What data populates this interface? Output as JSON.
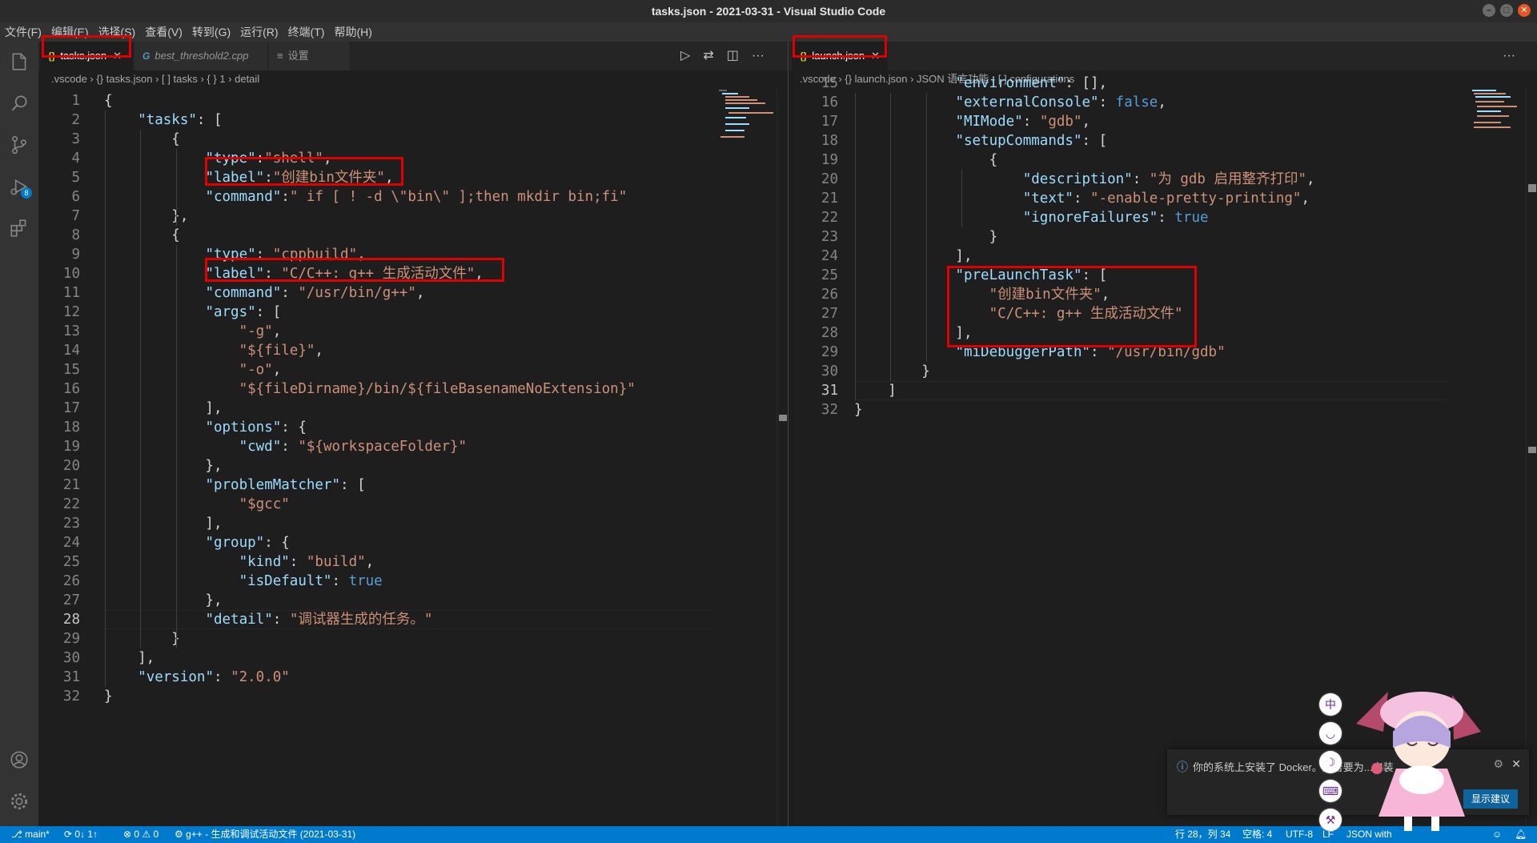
{
  "window": {
    "title": "tasks.json - 2021-03-31 - Visual Studio Code",
    "minimize": "–",
    "maximize": "□",
    "close": "✕"
  },
  "menu": [
    "文件(F)",
    "编辑(E)",
    "选择(S)",
    "查看(V)",
    "转到(G)",
    "运行(R)",
    "终端(T)",
    "帮助(H)"
  ],
  "activity": {
    "scm_badge": "8",
    "explorer_icon": "files-icon",
    "search_icon": "search-icon",
    "scm_icon": "source-control-icon",
    "debug_icon": "run-debug-icon",
    "ext_icon": "extensions-icon",
    "account_icon": "account-icon",
    "settings_icon": "gear-icon"
  },
  "left": {
    "tabs": [
      {
        "icon": "{}",
        "label": "tasks.json",
        "close": "✕"
      },
      {
        "icon": "G",
        "label": "best_threshold2.cpp"
      },
      {
        "icon": "≡",
        "label": "设置"
      }
    ],
    "breadcrumb": [
      ".vscode",
      "{} tasks.json",
      "[ ] tasks",
      "{ } 1",
      "detail"
    ],
    "actions": {
      "run": "▷",
      "compare": "⇄",
      "split": "◫",
      "more": "···"
    },
    "lines": [
      {
        "n": "1",
        "t": "{"
      },
      {
        "n": "2",
        "t": "    \"tasks\": ["
      },
      {
        "n": "3",
        "t": "        {"
      },
      {
        "n": "4",
        "t": "            \"type\":\"shell\","
      },
      {
        "n": "5",
        "t": "            \"label\":\"创建bin文件夹\","
      },
      {
        "n": "6",
        "t": "            \"command\":\" if [ ! -d \\\"bin\\\" ];then mkdir bin;fi\""
      },
      {
        "n": "7",
        "t": "        },"
      },
      {
        "n": "8",
        "t": "        {"
      },
      {
        "n": "9",
        "t": "            \"type\": \"cppbuild\","
      },
      {
        "n": "10",
        "t": "            \"label\": \"C/C++: g++ 生成活动文件\","
      },
      {
        "n": "11",
        "t": "            \"command\": \"/usr/bin/g++\","
      },
      {
        "n": "12",
        "t": "            \"args\": ["
      },
      {
        "n": "13",
        "t": "                \"-g\","
      },
      {
        "n": "14",
        "t": "                \"${file}\","
      },
      {
        "n": "15",
        "t": "                \"-o\","
      },
      {
        "n": "16",
        "t": "                \"${fileDirname}/bin/${fileBasenameNoExtension}\""
      },
      {
        "n": "17",
        "t": "            ],"
      },
      {
        "n": "18",
        "t": "            \"options\": {"
      },
      {
        "n": "19",
        "t": "                \"cwd\": \"${workspaceFolder}\""
      },
      {
        "n": "20",
        "t": "            },"
      },
      {
        "n": "21",
        "t": "            \"problemMatcher\": ["
      },
      {
        "n": "22",
        "t": "                \"$gcc\""
      },
      {
        "n": "23",
        "t": "            ],"
      },
      {
        "n": "24",
        "t": "            \"group\": {"
      },
      {
        "n": "25",
        "t": "                \"kind\": \"build\","
      },
      {
        "n": "26",
        "t": "                \"isDefault\": true"
      },
      {
        "n": "27",
        "t": "            },"
      },
      {
        "n": "28",
        "t": "            \"detail\": \"调试器生成的任务。\""
      },
      {
        "n": "29",
        "t": "        }"
      },
      {
        "n": "30",
        "t": "    ],"
      },
      {
        "n": "31",
        "t": "    \"version\": \"2.0.0\""
      },
      {
        "n": "32",
        "t": "}"
      }
    ]
  },
  "right": {
    "tabs": [
      {
        "icon": "{}",
        "label": "launch.json",
        "close": "✕"
      }
    ],
    "breadcrumb": [
      ".vscode",
      "{} launch.json",
      "JSON 语言功能",
      "[ ] configurations"
    ],
    "actions": {
      "more": "···"
    },
    "lines": [
      {
        "n": "15",
        "t": "            \"environment\": [],"
      },
      {
        "n": "16",
        "t": "            \"externalConsole\": false,"
      },
      {
        "n": "17",
        "t": "            \"MIMode\": \"gdb\","
      },
      {
        "n": "18",
        "t": "            \"setupCommands\": ["
      },
      {
        "n": "19",
        "t": "                {"
      },
      {
        "n": "20",
        "t": "                    \"description\": \"为 gdb 启用整齐打印\","
      },
      {
        "n": "21",
        "t": "                    \"text\": \"-enable-pretty-printing\","
      },
      {
        "n": "22",
        "t": "                    \"ignoreFailures\": true"
      },
      {
        "n": "23",
        "t": "                }"
      },
      {
        "n": "24",
        "t": "            ],"
      },
      {
        "n": "25",
        "t": "            \"preLaunchTask\": ["
      },
      {
        "n": "26",
        "t": "                \"创建bin文件夹\","
      },
      {
        "n": "27",
        "t": "                \"C/C++: g++ 生成活动文件\""
      },
      {
        "n": "28",
        "t": "            ],"
      },
      {
        "n": "29",
        "t": "            \"miDebuggerPath\": \"/usr/bin/gdb\""
      },
      {
        "n": "30",
        "t": "        }"
      },
      {
        "n": "31",
        "t": "    ]"
      },
      {
        "n": "32",
        "t": "}"
      }
    ]
  },
  "notification": {
    "message": "你的系统上安装了 Docker。是否要为...安装",
    "button_primary": "显示建议",
    "close": "✕",
    "gear": "⚙",
    "info_icon": "ⓘ"
  },
  "ime": [
    "中",
    "◡",
    "☽",
    "⌨",
    "⚒"
  ],
  "status": {
    "branch": "main*",
    "sync": "⟳ 0↓ 1↑",
    "problems": "⊗ 0 ⚠ 0",
    "task": "g++ - 生成和调试活动文件 (2021-03-31)",
    "position": "行 28，列 34",
    "spaces": "空格: 4",
    "encoding": "UTF-8",
    "eol": "LF",
    "language": "JSON with"
  },
  "colors": {
    "accent": "#007acc",
    "highlight_box": "#e00000",
    "key": "#9cdcfe",
    "string": "#ce9178",
    "bool": "#569cd6"
  }
}
